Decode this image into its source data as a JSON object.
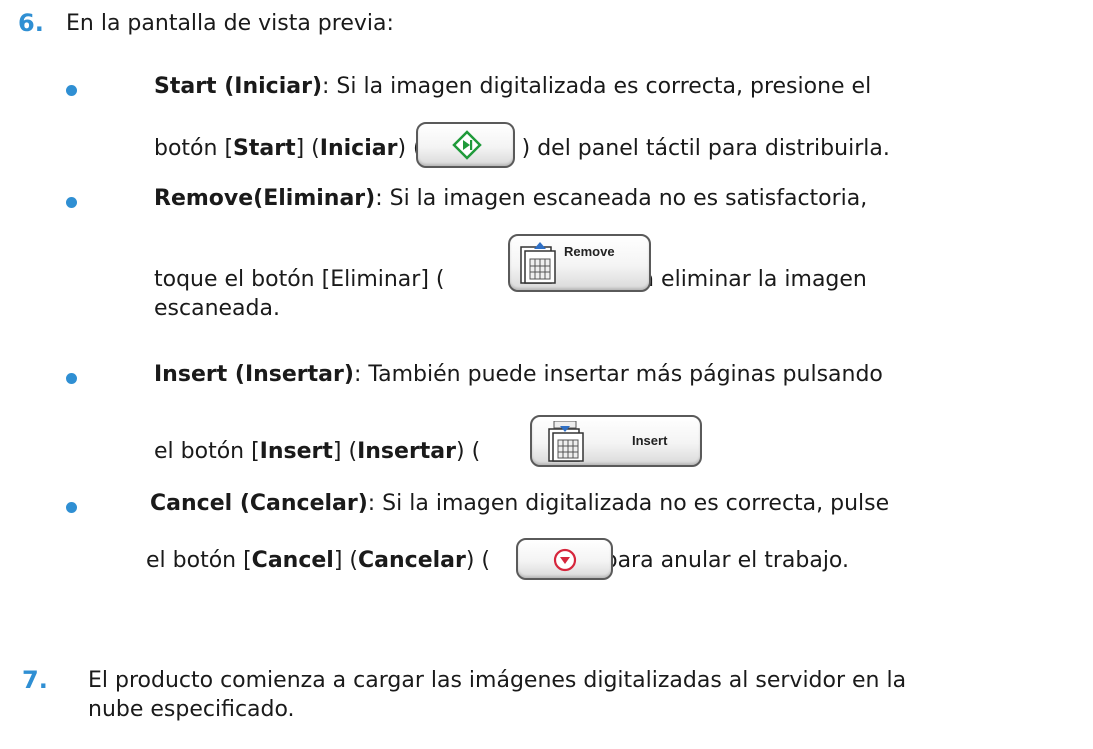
{
  "step6": {
    "number": "6.",
    "intro": "En la pantalla de vista previa:",
    "start": {
      "term": "Start (Iniciar)",
      "line1": ": Si la imagen digitalizada es correcta, presione el",
      "pre": "botón [",
      "key": "Start",
      "mid": "] (",
      "key2": "Iniciar",
      "open": ") (",
      "post": ") del panel táctil para distribuirla.",
      "icon": "start-diamond-icon",
      "icon_color": "#1f9a3a"
    },
    "remove": {
      "term": "Remove(Eliminar)",
      "line1": ": Si la imagen escaneada no es satisfactoria,",
      "pre": "toque el botón [Eliminar] (",
      "post": ") para eliminar la imagen",
      "line3": "escaneada.",
      "button_label": "Remove",
      "icon": "remove-pages-icon"
    },
    "insert": {
      "term": "Insert (Insertar)",
      "line1": ": También puede insertar más páginas pulsando",
      "pre": "el botón [",
      "key": "Insert",
      "mid": "] (",
      "key2": "Insertar",
      "open": ") (",
      "post": ").",
      "button_label": "Insert",
      "icon": "insert-pages-icon"
    },
    "cancel": {
      "term": "Cancel (Cancelar)",
      "line1": ": Si la imagen digitalizada no es correcta, pulse",
      "pre": "el botón [",
      "key": "Cancel",
      "mid": "] (",
      "key2": "Cancelar",
      "open": ") (",
      "post": ") para anular el trabajo.",
      "icon": "cancel-stop-icon",
      "icon_color": "#d6263c"
    }
  },
  "step7": {
    "number": "7.",
    "line1": "El producto comienza a cargar las imágenes digitalizadas al servidor en la",
    "line2": "nube especificado."
  },
  "colors": {
    "accent": "#2f8fd3",
    "text": "#1a1a1a"
  }
}
